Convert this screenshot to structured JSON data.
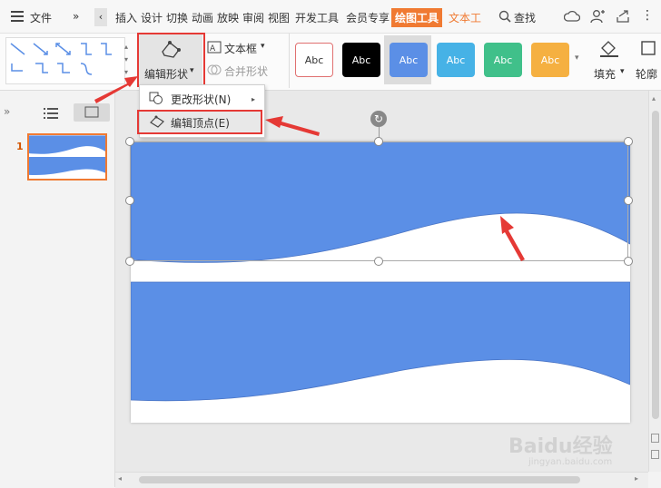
{
  "menu": {
    "file": "文件",
    "tabs": [
      "插入",
      "设计",
      "切换",
      "动画",
      "放映",
      "审阅",
      "视图",
      "开发工具",
      "会员专享"
    ],
    "active_tab": "绘图工具",
    "text_tool_tab": "文本工",
    "search": "查找"
  },
  "ribbon": {
    "edit_shape": "编辑形状",
    "text_box": "文本框",
    "merge_shape": "合并形状",
    "style_label": "Abc",
    "fill": "填充",
    "outline": "轮廓"
  },
  "dropdown": {
    "change_shape": "更改形状(N)",
    "edit_points": "编辑顶点(E)"
  },
  "slides": {
    "slide_number": "1"
  },
  "colors": {
    "accent_orange": "#f07a32",
    "shape_blue": "#5b8fe6",
    "highlight_red": "#e53935"
  },
  "watermark": {
    "brand": "Baidu经验",
    "url": "jingyan.baidu.com"
  }
}
